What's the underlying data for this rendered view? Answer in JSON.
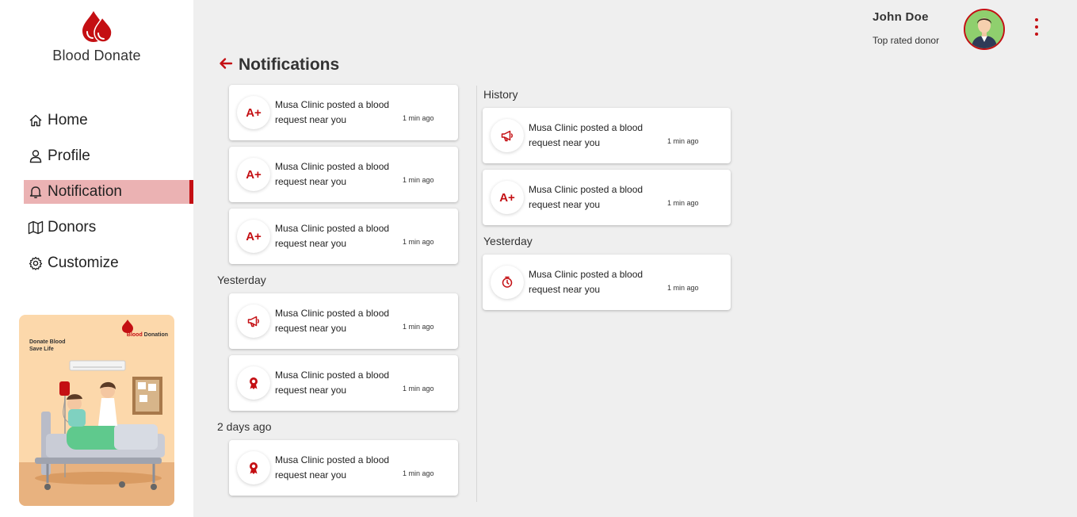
{
  "app": {
    "name": "Blood Donate"
  },
  "sidebar": {
    "items": [
      {
        "label": "Home",
        "icon": "home-icon"
      },
      {
        "label": "Profile",
        "icon": "user-icon"
      },
      {
        "label": "Notification",
        "icon": "bell-icon",
        "active": true
      },
      {
        "label": "Donors",
        "icon": "map-icon"
      },
      {
        "label": "Customize",
        "icon": "gear-icon"
      }
    ],
    "promo": {
      "line1": "Donate Blood",
      "line2": "Save Life",
      "brand1": "Blood",
      "brand2": "Donation"
    }
  },
  "header": {
    "user_name": "John Doe",
    "user_role": "Top rated donor"
  },
  "page": {
    "title": "Notifications"
  },
  "colors": {
    "accent": "#c40f13",
    "active_bg": "#ebb2b3",
    "background": "#efefef"
  },
  "left_column": {
    "today": [
      {
        "icon": "blood-type-icon",
        "badge": "A+",
        "message": "Musa Clinic posted a blood request near you",
        "time": "1 min ago"
      },
      {
        "icon": "blood-type-icon",
        "badge": "A+",
        "message": "Musa Clinic posted a blood request near you",
        "time": "1 min ago"
      },
      {
        "icon": "blood-type-icon",
        "badge": "A+",
        "message": "Musa Clinic posted a blood request near you",
        "time": "1 min ago"
      }
    ],
    "yesterday_label": "Yesterday",
    "yesterday": [
      {
        "icon": "megaphone-icon",
        "message": "Musa Clinic posted a blood request near you",
        "time": "1 min ago"
      },
      {
        "icon": "award-icon",
        "message": "Musa Clinic posted a blood request near you",
        "time": "1 min ago"
      }
    ],
    "two_days_label": "2 days ago",
    "two_days": [
      {
        "icon": "award-icon",
        "message": "Musa Clinic posted a blood request near you",
        "time": "1 min ago"
      }
    ]
  },
  "right_column": {
    "history_label": "History",
    "history": [
      {
        "icon": "megaphone-icon",
        "message": "Musa Clinic posted a blood request near you",
        "time": "1 min ago"
      },
      {
        "icon": "blood-type-icon",
        "badge": "A+",
        "message": "Musa Clinic posted a blood request near you",
        "time": "1 min ago"
      }
    ],
    "yesterday_label": "Yesterday",
    "yesterday": [
      {
        "icon": "timer-icon",
        "message": "Musa Clinic posted a blood request near you",
        "time": "1 min ago"
      }
    ]
  }
}
